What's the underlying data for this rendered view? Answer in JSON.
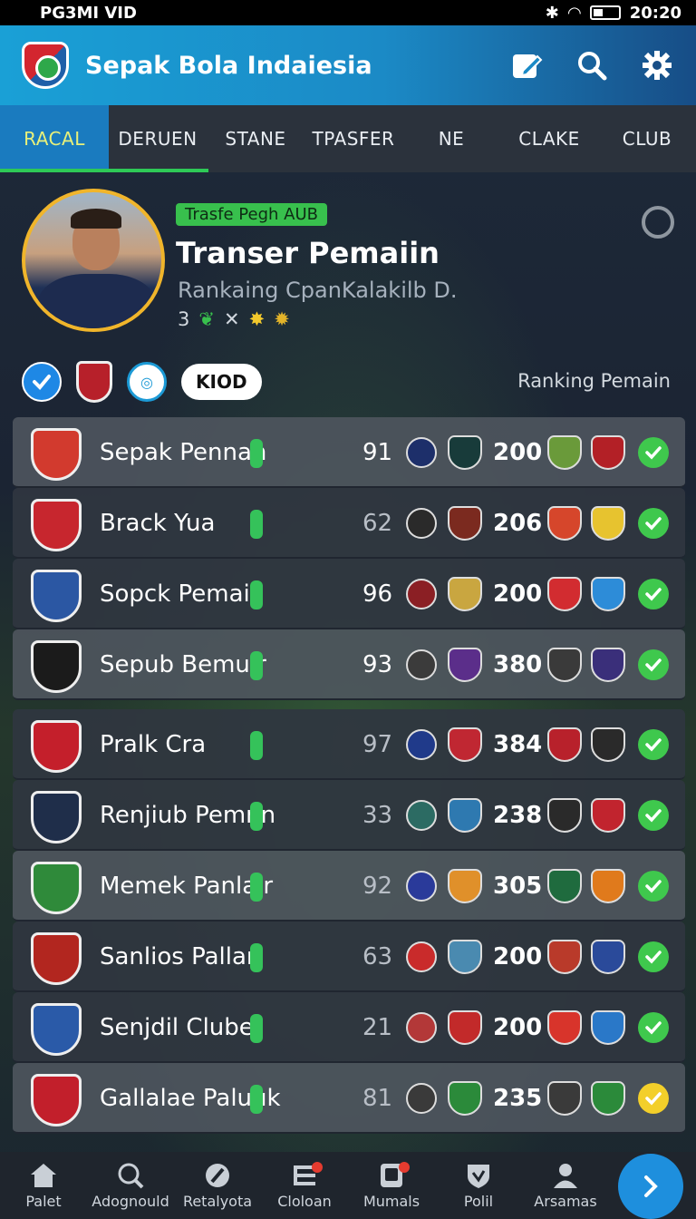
{
  "status_bar": {
    "left": "PG3MI VID",
    "time": "20:20"
  },
  "header": {
    "title": "Sepak Bola Indaiesia",
    "icons": [
      "edit-icon",
      "search-icon",
      "gear-icon"
    ]
  },
  "tabs": [
    "RACAL",
    "DERUEN",
    "STANE",
    "TPASFER",
    "NE",
    "CLAKE",
    "CLUB"
  ],
  "profile": {
    "badge": "Trasfe Pegh AUB",
    "title": "Transer Pemaiin",
    "subtitle": "Rankaing CpanKalakilb D.",
    "stats": "3"
  },
  "filters": {
    "pill": "KIOD",
    "ranking_label": "Ranking Pemain"
  },
  "rows": [
    {
      "name": "Sepak Pennan",
      "n1": "91",
      "n2": "200",
      "c1": "#d23a2e",
      "m1": "#1d2f6a",
      "m2": "#183b3a",
      "m3": "#6a9a3a",
      "m4": "#b32026",
      "status": "green"
    },
    {
      "name": "Brack Yua",
      "n1": "62",
      "n2": "206",
      "c1": "#c7262e",
      "m1": "#2a2a2a",
      "m2": "#7b2a1f",
      "m3": "#d6462b",
      "m4": "#e7c32f",
      "status": "green"
    },
    {
      "name": "Sopck Pemair",
      "n1": "96",
      "n2": "200",
      "c1": "#2b57a3",
      "m1": "#8b1f24",
      "m2": "#c9a640",
      "m3": "#d22c30",
      "m4": "#2d8cd8",
      "status": "green"
    },
    {
      "name": "Sepub Bemuir",
      "n1": "93",
      "n2": "380",
      "c1": "#1b1b1b",
      "m1": "#3b3b3b",
      "m2": "#5b2e8a",
      "m3": "#3a3a3a",
      "m4": "#3a2f7a",
      "status": "green"
    },
    {
      "name": "Pralk Cra",
      "n1": "97",
      "n2": "384",
      "c1": "#c41f2b",
      "m1": "#203a8a",
      "m2": "#c02732",
      "m3": "#b8212b",
      "m4": "#2a2a2a",
      "status": "green"
    },
    {
      "name": "Renjiub Pemnn",
      "n1": "33",
      "n2": "238",
      "c1": "#1f2e4a",
      "m1": "#2c6b63",
      "m2": "#2e79b0",
      "m3": "#2a2a2a",
      "m4": "#c1242e",
      "status": "green"
    },
    {
      "name": "Memek Panlair",
      "n1": "92",
      "n2": "305",
      "c1": "#2f8a3a",
      "m1": "#2a3a9a",
      "m2": "#e0902a",
      "m3": "#1f6b3e",
      "m4": "#e07a1c",
      "status": "green"
    },
    {
      "name": "Sanlios Pallan",
      "n1": "63",
      "n2": "200",
      "c1": "#b2261f",
      "m1": "#c92b2b",
      "m2": "#4a8ab0",
      "m3": "#b93a2a",
      "m4": "#2a4a9a",
      "status": "green"
    },
    {
      "name": "Senjdil Clube",
      "n1": "21",
      "n2": "200",
      "c1": "#2a5aa8",
      "m1": "#b33838",
      "m2": "#c22a2a",
      "m3": "#d8342b",
      "m4": "#2a78c8",
      "status": "green"
    },
    {
      "name": "Gallalae Paluuk",
      "n1": "81",
      "n2": "235",
      "c1": "#c21f2b",
      "m1": "#3a3a3a",
      "m2": "#2b8a3a",
      "m3": "#3a3a3a",
      "m4": "#2b8a3a",
      "status": "yellow"
    }
  ],
  "bottom_nav": [
    "Palet",
    "Adognould",
    "Retalyota",
    "Cloloan",
    "Mumals",
    "Polil",
    "Arsamas"
  ]
}
